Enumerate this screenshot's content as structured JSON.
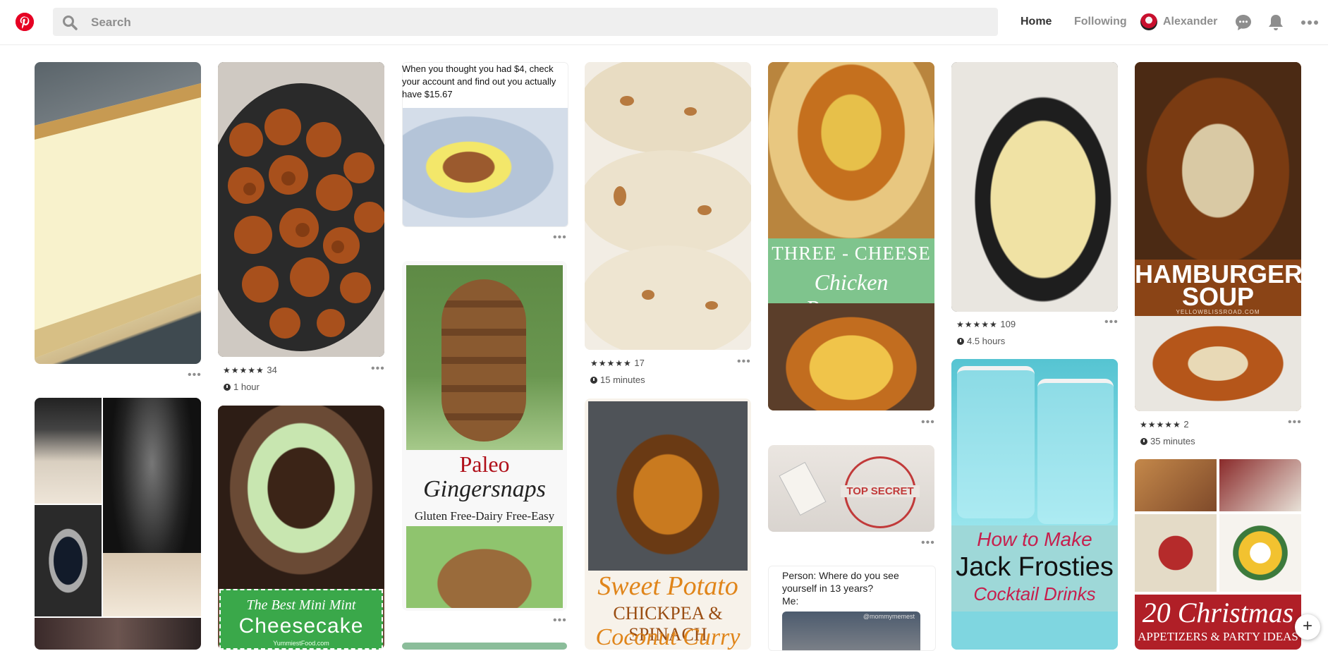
{
  "header": {
    "search_placeholder": "Search",
    "nav_home": "Home",
    "nav_following": "Following",
    "user_name": "Alexander",
    "icons": [
      "pinterest-logo",
      "search-icon",
      "messages-icon",
      "notifications-icon",
      "more-icon"
    ],
    "brand_color": "#e60023"
  },
  "pins": {
    "meme1_caption": "When you thought you had $4, check your account and find out you actually have $15.67",
    "potatoes": {
      "stars": "★★★★★",
      "count": "34",
      "time": "1 hour"
    },
    "cookies": {
      "stars": "★★★★★",
      "count": "17",
      "time": "15 minutes"
    },
    "dip": {
      "stars": "★★★★★",
      "count": "109",
      "time": "4.5 hours"
    },
    "soup": {
      "stars": "★★★★★",
      "count": "2",
      "time": "35 minutes"
    },
    "soup_title_line1": "HAMBURGER",
    "soup_title_line2": "SOUP",
    "soup_source": "YELLOWBLISSROAD.COM",
    "parm_line1": "THREE - CHEESE",
    "parm_line2": "Chicken Parmesan",
    "gingersnaps_line1": "Paleo",
    "gingersnaps_line2": "Gingersnaps",
    "gingersnaps_line3": "Gluten Free-Dairy Free-Easy",
    "mint_line1": "The Best Mini Mint",
    "mint_line2": "Cheesecake",
    "mint_source": "YummiestFood.com",
    "curry_line1": "Sweet Potato",
    "curry_line2": "CHICKPEA & SPINACH",
    "curry_line3": "Coconut Curry",
    "secret_stamp": "TOP SECRET",
    "frosties_line1": "How to Make",
    "frosties_line2": "Jack Frosties",
    "frosties_line3": "Cocktail Drinks",
    "meme2_caption": "Person: Where do you see yourself in 13 years?\nMe:",
    "meme2_handle": "@mommymemest",
    "xmas_line1": "20 Christmas",
    "xmas_line2": "APPETIZERS & PARTY IDEAS",
    "more_label": "•••"
  },
  "fab_label": "+"
}
